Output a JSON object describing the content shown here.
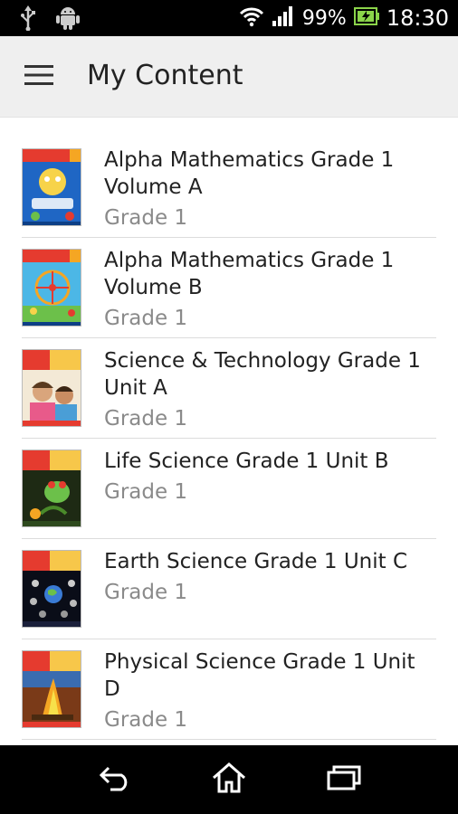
{
  "status_bar": {
    "battery_percent": "99%",
    "time": "18:30",
    "icons": [
      "usb-icon",
      "android-icon",
      "wifi-icon",
      "signal-icon",
      "battery-icon"
    ]
  },
  "app_bar": {
    "title": "My Content",
    "menu_icon": "hamburger-menu-icon"
  },
  "content": {
    "items": [
      {
        "title": "Alpha Mathematics Grade 1 Volume A",
        "subtitle": "Grade 1",
        "cover": "alpha-mathematics-cover"
      },
      {
        "title": "Alpha Mathematics Grade 1 Volume B",
        "subtitle": "Grade 1",
        "cover": "alpha-mathematics-cover"
      },
      {
        "title": "Science & Technology Grade 1 Unit A",
        "subtitle": "Grade 1",
        "cover": "alpha-science-cover"
      },
      {
        "title": "Life Science Grade 1 Unit B",
        "subtitle": "Grade 1",
        "cover": "alpha-science-cover"
      },
      {
        "title": "Earth Science Grade 1 Unit C",
        "subtitle": "Grade 1",
        "cover": "alpha-science-cover"
      },
      {
        "title": "Physical Science Grade 1 Unit D",
        "subtitle": "Grade 1",
        "cover": "alpha-science-cover"
      }
    ]
  },
  "nav_bar": {
    "icons": [
      "back-icon",
      "home-icon",
      "recent-apps-icon"
    ]
  },
  "colors": {
    "status_bar": "#000000",
    "app_bar": "#efefef",
    "title_text": "#222222",
    "subtitle_text": "#8a8a8a",
    "battery_green": "#8bd44a"
  }
}
